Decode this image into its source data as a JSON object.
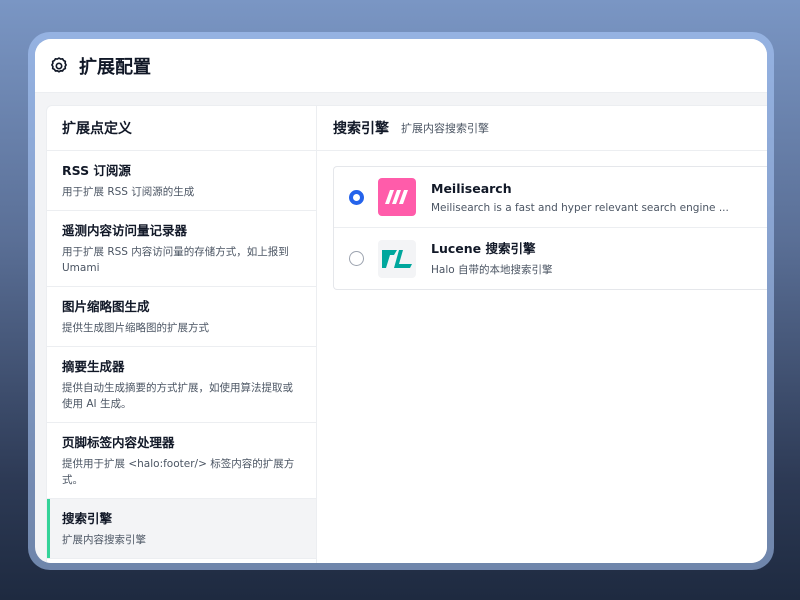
{
  "header": {
    "title": "扩展配置",
    "icon": "gear-icon"
  },
  "sidebar": {
    "title": "扩展点定义",
    "items": [
      {
        "label": "RSS 订阅源",
        "desc": "用于扩展 RSS 订阅源的生成"
      },
      {
        "label": "遥测内容访问量记录器",
        "desc": "用于扩展 RSS 内容访问量的存储方式，如上报到 Umami"
      },
      {
        "label": "图片缩略图生成",
        "desc": "提供生成图片缩略图的扩展方式"
      },
      {
        "label": "摘要生成器",
        "desc": "提供自动生成摘要的方式扩展，如使用算法提取或使用 AI 生成。"
      },
      {
        "label": "页脚标签内容处理器",
        "desc": "提供用于扩展 <halo:footer/> 标签内容的扩展方式。"
      },
      {
        "label": "搜索引擎",
        "desc": "扩展内容搜索引擎",
        "active": true
      }
    ]
  },
  "main": {
    "title": "搜索引擎",
    "subtitle": "扩展内容搜索引擎",
    "options": [
      {
        "name": "Meilisearch",
        "desc": "Meilisearch is a fast and hyper relevant search engine ...",
        "selected": true
      },
      {
        "name": "Lucene 搜索引擎",
        "desc": "Halo 自带的本地搜索引擎",
        "selected": false
      }
    ]
  },
  "colors": {
    "accent": "#34d399",
    "radio": "#2563eb",
    "meili_brand": "#ff5caa",
    "lucene_brand": "#00a79d"
  }
}
